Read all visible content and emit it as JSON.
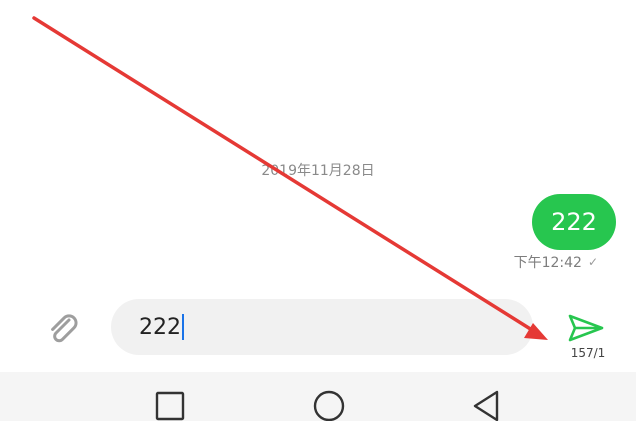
{
  "conversation": {
    "date_label": "2019年11月28日",
    "message": {
      "text": "222",
      "time": "下午12:42",
      "status_icon": "check-icon"
    }
  },
  "composer": {
    "attach_icon": "paperclip-icon",
    "input_value": "222",
    "send_icon": "send-icon",
    "char_counter": "157/1"
  },
  "nav_bar": {
    "recents_icon": "square-icon",
    "home_icon": "circle-icon",
    "back_icon": "triangle-back-icon"
  },
  "colors": {
    "bubble": "#27c64f",
    "send": "#27c64f",
    "annotation_arrow": "#e53935",
    "caret": "#1a73e8"
  }
}
